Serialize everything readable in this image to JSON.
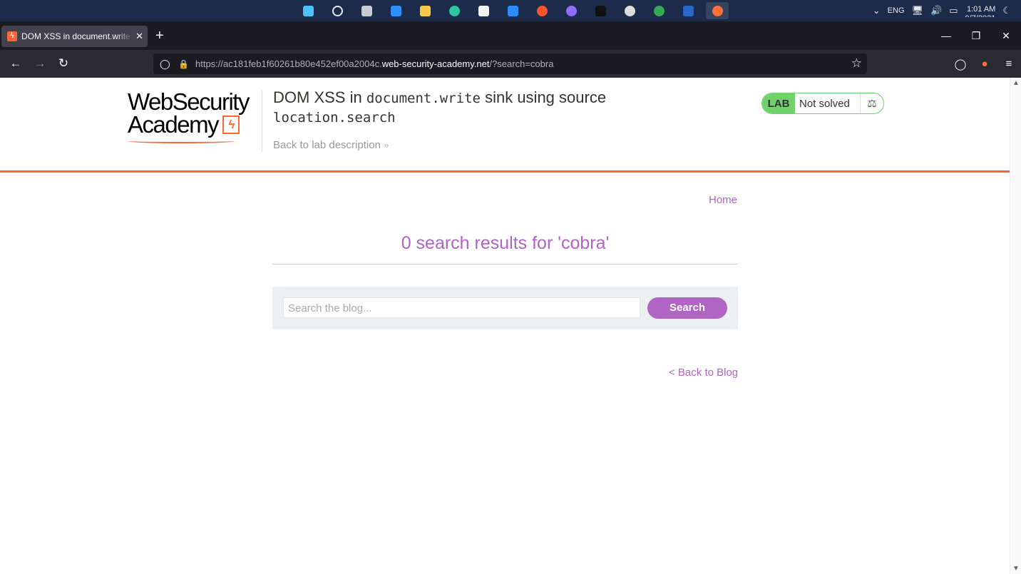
{
  "taskbar": {
    "apps": [
      {
        "name": "windows-start-icon",
        "color": "#4cc2ff"
      },
      {
        "name": "search-icon",
        "color": "#e6e9f0"
      },
      {
        "name": "task-view-icon",
        "color": "#c7ccd6"
      },
      {
        "name": "widgets-icon",
        "color": "#2f8fff"
      },
      {
        "name": "file-explorer-icon",
        "color": "#f7c948"
      },
      {
        "name": "edge-icon",
        "color": "#2ec4a5"
      },
      {
        "name": "store-icon",
        "color": "#f3f3f3"
      },
      {
        "name": "mail-icon",
        "color": "#2a8cff"
      },
      {
        "name": "brave-icon",
        "color": "#fb542b"
      },
      {
        "name": "messenger-icon",
        "color": "#8d6cff"
      },
      {
        "name": "terminal-icon",
        "color": "#111111"
      },
      {
        "name": "obs-icon",
        "color": "#dddddd"
      },
      {
        "name": "chrome-icon",
        "color": "#34a853"
      },
      {
        "name": "word-icon",
        "color": "#2b66c9"
      },
      {
        "name": "firefox-icon",
        "color": "#ff7139"
      }
    ],
    "tray": {
      "language": "ENG",
      "time": "1:01 AM",
      "date": "9/7/2021"
    }
  },
  "browser": {
    "tab_title": "DOM XSS in document.write sink using source location.search",
    "url_prefix": "https://ac181feb1f60261b80e452ef00a2004c.",
    "url_domain": "web-security-academy.net",
    "url_suffix": "/?search=cobra"
  },
  "header": {
    "logo_line1": "WebSecurity",
    "logo_line2": "Academy",
    "title_part1": "DOM XSS in ",
    "title_code1": "document.write",
    "title_part2": " sink using source ",
    "title_code2": "location.search",
    "back_link": "Back to lab description",
    "badge_label": "LAB",
    "badge_status": "Not solved"
  },
  "main": {
    "home_link": "Home",
    "results_heading": "0 search results for 'cobra'",
    "search_placeholder": "Search the blog...",
    "search_button": "Search",
    "back_to_blog": "< Back to Blog"
  },
  "colors": {
    "accent": "#b064c4",
    "brand_orange": "#ff6633",
    "lab_green": "#70d16d"
  }
}
